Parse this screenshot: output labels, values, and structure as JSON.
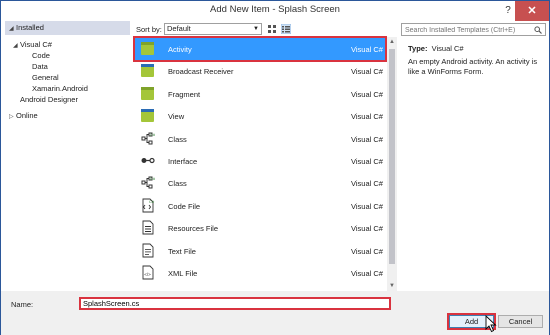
{
  "window": {
    "title": "Add New Item - Splash Screen",
    "help": "?",
    "close": "✕"
  },
  "tree": {
    "header": "Installed",
    "root": "Visual C#",
    "children": [
      "Code",
      "Data",
      "General",
      "Xamarin.Android"
    ],
    "sibling": "Android Designer",
    "online": "Online"
  },
  "sort": {
    "label": "Sort by:",
    "value": "Default"
  },
  "items": [
    {
      "name": "Activity",
      "type": "Visual C#",
      "icon": "android-activity-icon",
      "selected": true
    },
    {
      "name": "Broadcast Receiver",
      "type": "Visual C#",
      "icon": "broadcast-receiver-icon"
    },
    {
      "name": "Fragment",
      "type": "Visual C#",
      "icon": "fragment-icon"
    },
    {
      "name": "View",
      "type": "Visual C#",
      "icon": "view-icon"
    },
    {
      "name": "Class",
      "type": "Visual C#",
      "icon": "class-icon"
    },
    {
      "name": "Interface",
      "type": "Visual C#",
      "icon": "interface-icon"
    },
    {
      "name": "Class",
      "type": "Visual C#",
      "icon": "class-icon"
    },
    {
      "name": "Code File",
      "type": "Visual C#",
      "icon": "code-file-icon"
    },
    {
      "name": "Resources File",
      "type": "Visual C#",
      "icon": "resources-file-icon"
    },
    {
      "name": "Text File",
      "type": "Visual C#",
      "icon": "text-file-icon"
    },
    {
      "name": "XML File",
      "type": "Visual C#",
      "icon": "xml-file-icon"
    }
  ],
  "details": {
    "search_placeholder": "Search Installed Templates (Ctrl+E)",
    "type_label": "Type:",
    "type_value": "Visual C#",
    "description": "An empty Android activity.  An activity is like a WinForms Form."
  },
  "bottom": {
    "name_label": "Name:",
    "name_value": "SplashScreen.cs",
    "add_label": "Add",
    "cancel_label": "Cancel"
  },
  "colors": {
    "selection": "#3399ff",
    "highlight": "#d9333f",
    "android_green": "#a4c639"
  }
}
